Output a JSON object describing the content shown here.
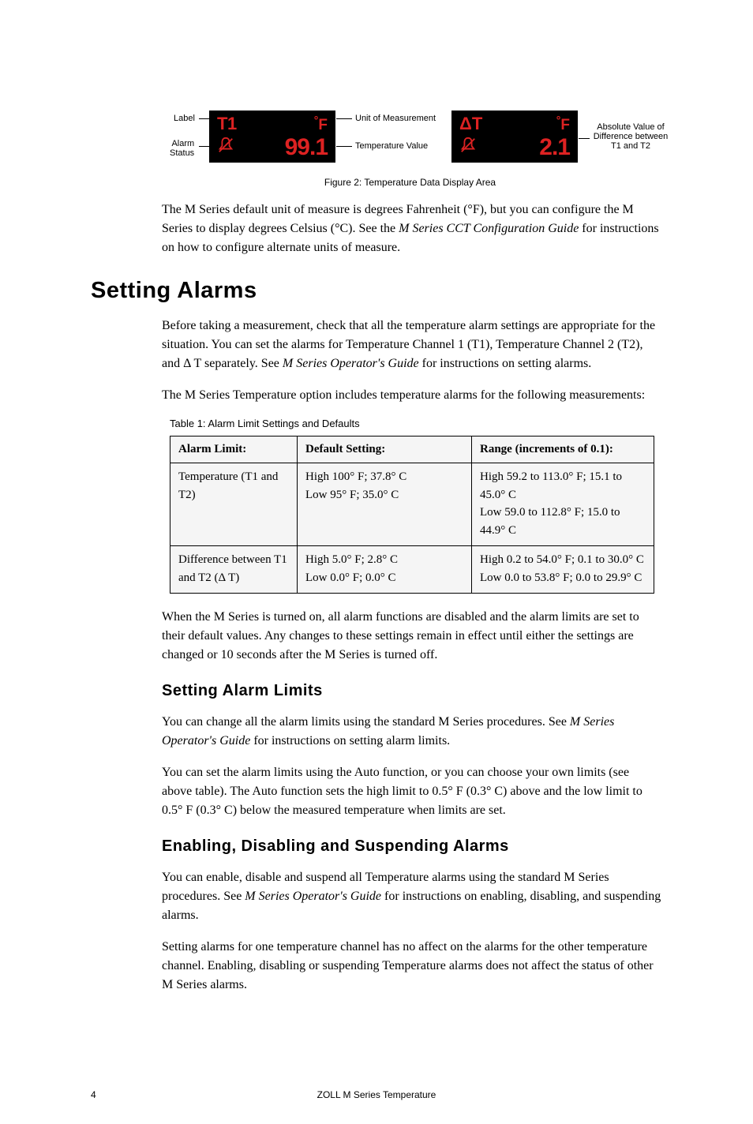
{
  "figure": {
    "box1": {
      "label": "T1",
      "unit": "°F",
      "value": "99.1"
    },
    "box2": {
      "label": "ΔT",
      "unit": "°F",
      "value": "2.1"
    },
    "callouts": {
      "label": "Label",
      "alarm_status": "Alarm\nStatus",
      "unit": "Unit of Measurement",
      "temp_value": "Temperature Value",
      "abs_value": "Absolute Value of Difference between T1 and T2"
    },
    "caption": "Figure 2: Temperature Data Display Area"
  },
  "intro_para": "The M Series default unit of measure is degrees Fahrenheit (°F), but you can configure the M Series to display degrees Celsius (°C). See the ",
  "intro_guide": "M Series CCT Configuration Guide",
  "intro_para_tail": " for instructions on how to configure alternate units of measure.",
  "h1": "Setting Alarms",
  "p1a": "Before taking a measurement, check that all the temperature alarm settings are appropriate for the situation. You can set the alarms for Temperature Channel 1 (T1), Temperature Channel 2 (T2), and Δ T separately. See ",
  "p1_guide": "M Series Operator's Guide",
  "p1b": " for instructions on setting alarms.",
  "p2": "The M Series Temperature option includes temperature alarms for the following measurements:",
  "table_caption": "Table 1: Alarm Limit Settings and Defaults",
  "table": {
    "headers": [
      "Alarm Limit:",
      "Default Setting:",
      "Range (increments of 0.1):"
    ],
    "rows": [
      {
        "c1": "Temperature (T1 and T2)",
        "c2a": "High 100° F; 37.8° C",
        "c2b": "Low 95° F; 35.0° C",
        "c3a": "High 59.2 to 113.0° F; 15.1 to 45.0° C",
        "c3b": "Low 59.0 to 112.8° F; 15.0 to 44.9° C"
      },
      {
        "c1": "Difference between T1 and T2 (Δ T)",
        "c2a": "High 5.0° F; 2.8° C",
        "c2b": "Low 0.0° F; 0.0° C",
        "c3a": "High 0.2 to 54.0° F; 0.1 to 30.0° C",
        "c3b": "Low 0.0 to 53.8° F; 0.0 to 29.9° C"
      }
    ]
  },
  "p3": "When the M Series is turned on, all alarm functions are disabled and the alarm limits are set to their default values. Any changes to these settings remain in effect until either the settings are changed or 10 seconds after the M Series is turned off.",
  "h2a": "Setting Alarm Limits",
  "p4a": "You can change all the alarm limits using the standard M Series procedures. See ",
  "p4_guide": "M Series Operator's Guide",
  "p4b": " for instructions on setting alarm limits.",
  "p5": "You can set the alarm limits using the Auto function, or you can choose your own limits (see above table). The Auto function sets the high limit to 0.5° F (0.3° C) above and the low limit to 0.5° F (0.3° C) below the measured temperature when limits are set.",
  "h2b": "Enabling, Disabling and Suspending Alarms",
  "p6a": "You can enable, disable and suspend all Temperature alarms using the standard M Series procedures. See ",
  "p6_guide": "M Series Operator's Guide",
  "p6b": " for instructions on enabling, disabling, and suspending alarms.",
  "p7": "Setting alarms for one temperature channel has no affect on the alarms for the other temperature channel. Enabling, disabling or suspending Temperature alarms does not affect the status of other M Series alarms.",
  "footer": {
    "page": "4",
    "title": "ZOLL M Series Temperature"
  }
}
